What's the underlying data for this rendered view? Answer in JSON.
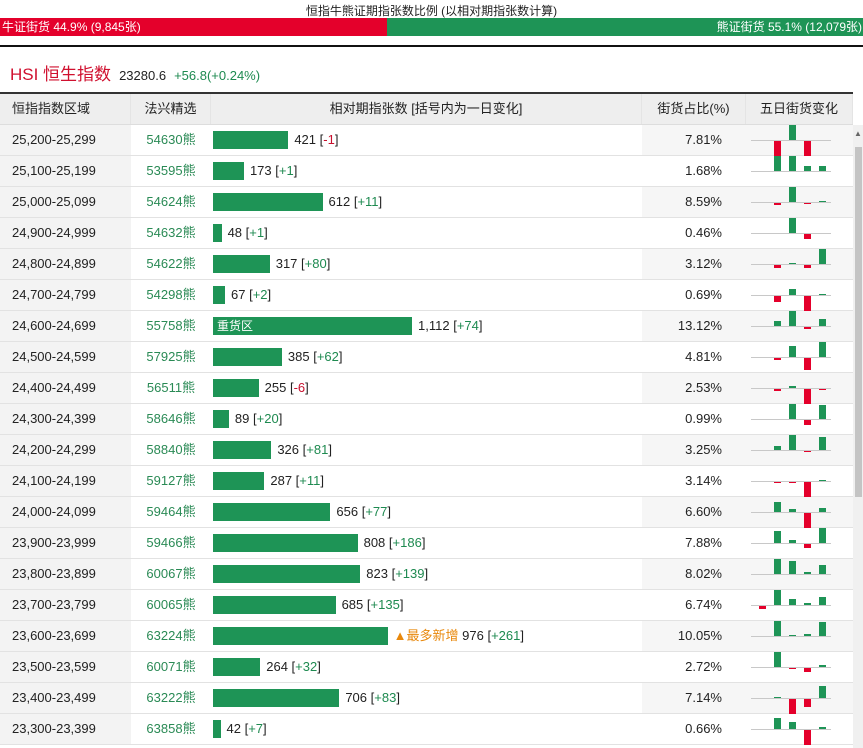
{
  "title": "恒指牛熊证期指张数比例 (以相对期指张数计算)",
  "ratio": {
    "bull_label": "牛证街货 44.9% (9,845张)",
    "bull_pct": 44.9,
    "bear_label": "熊证街货 55.1% (12,079张)",
    "bear_pct": 55.1
  },
  "index": {
    "name": "HSI 恒生指数",
    "value": "23280.6",
    "change": "+56.8(+0.24%)"
  },
  "headers": [
    "恒指指数区域",
    "法兴精选",
    "相对期指张数 [括号内为一日变化]",
    "街货占比(%)",
    "五日街货变化"
  ],
  "colors": {
    "green": "#1e9456",
    "red": "#e4002b",
    "note": "#e8880c"
  },
  "rows": [
    {
      "range": "25,200-25,299",
      "code": "54630熊",
      "count": 421,
      "count_label": "421",
      "delta": "-1",
      "pct": "7.81%",
      "five": [
        0,
        -15,
        15,
        -15,
        0
      ]
    },
    {
      "range": "25,100-25,199",
      "code": "53595熊",
      "count": 173,
      "count_label": "173",
      "delta": "+1",
      "pct": "1.68%",
      "five": [
        0,
        15,
        15,
        5,
        5
      ]
    },
    {
      "range": "25,000-25,099",
      "code": "54624熊",
      "count": 612,
      "count_label": "612",
      "delta": "+11",
      "pct": "8.59%",
      "five": [
        0,
        -2,
        15,
        -1,
        1
      ]
    },
    {
      "range": "24,900-24,999",
      "code": "54632熊",
      "count": 48,
      "count_label": "48",
      "delta": "+1",
      "pct": "0.46%",
      "five": [
        0,
        0,
        15,
        -5,
        0
      ]
    },
    {
      "range": "24,800-24,899",
      "code": "54622熊",
      "count": 317,
      "count_label": "317",
      "delta": "+80",
      "pct": "3.12%",
      "five": [
        0,
        -3,
        1,
        -3,
        15
      ]
    },
    {
      "range": "24,700-24,799",
      "code": "54298熊",
      "count": 67,
      "count_label": "67",
      "delta": "+2",
      "pct": "0.69%",
      "five": [
        0,
        -6,
        6,
        -15,
        1
      ]
    },
    {
      "range": "24,600-24,699",
      "code": "55758熊",
      "count": 1112,
      "count_label": "1,112",
      "delta": "+74",
      "pct": "13.12%",
      "bar_text": "重货区",
      "five": [
        0,
        5,
        15,
        -2,
        7
      ]
    },
    {
      "range": "24,500-24,599",
      "code": "57925熊",
      "count": 385,
      "count_label": "385",
      "delta": "+62",
      "pct": "4.81%",
      "five": [
        0,
        -2,
        11,
        -12,
        15
      ]
    },
    {
      "range": "24,400-24,499",
      "code": "56511熊",
      "count": 255,
      "count_label": "255",
      "delta": "-6",
      "pct": "2.53%",
      "five": [
        0,
        -2,
        2,
        -15,
        -1
      ]
    },
    {
      "range": "24,300-24,399",
      "code": "58646熊",
      "count": 89,
      "count_label": "89",
      "delta": "+20",
      "pct": "0.99%",
      "five": [
        0,
        0,
        15,
        -5,
        14
      ]
    },
    {
      "range": "24,200-24,299",
      "code": "58840熊",
      "count": 326,
      "count_label": "326",
      "delta": "+81",
      "pct": "3.25%",
      "five": [
        0,
        4,
        15,
        -1,
        13
      ]
    },
    {
      "range": "24,100-24,199",
      "code": "59127熊",
      "count": 287,
      "count_label": "287",
      "delta": "+11",
      "pct": "3.14%",
      "five": [
        0,
        -1,
        -1,
        -15,
        1
      ]
    },
    {
      "range": "24,000-24,099",
      "code": "59464熊",
      "count": 656,
      "count_label": "656",
      "delta": "+77",
      "pct": "6.60%",
      "five": [
        0,
        10,
        3,
        -15,
        4
      ]
    },
    {
      "range": "23,900-23,999",
      "code": "59466熊",
      "count": 808,
      "count_label": "808",
      "delta": "+186",
      "pct": "7.88%",
      "five": [
        0,
        12,
        3,
        -4,
        15
      ]
    },
    {
      "range": "23,800-23,899",
      "code": "60067熊",
      "count": 823,
      "count_label": "823",
      "delta": "+139",
      "pct": "8.02%",
      "five": [
        0,
        15,
        13,
        2,
        9
      ]
    },
    {
      "range": "23,700-23,799",
      "code": "60065熊",
      "count": 685,
      "count_label": "685",
      "delta": "+135",
      "pct": "6.74%",
      "five": [
        -3,
        15,
        6,
        2,
        8
      ]
    },
    {
      "range": "23,600-23,699",
      "code": "63224熊",
      "count": 976,
      "count_label": "976",
      "delta": "+261",
      "pct": "10.05%",
      "note": "▲最多新增",
      "five": [
        0,
        15,
        1,
        2,
        14
      ]
    },
    {
      "range": "23,500-23,599",
      "code": "60071熊",
      "count": 264,
      "count_label": "264",
      "delta": "+32",
      "pct": "2.72%",
      "five": [
        0,
        15,
        -1,
        -4,
        2
      ]
    },
    {
      "range": "23,400-23,499",
      "code": "63222熊",
      "count": 706,
      "count_label": "706",
      "delta": "+83",
      "pct": "7.14%",
      "five": [
        0,
        1,
        -15,
        -8,
        12
      ]
    },
    {
      "range": "23,300-23,399",
      "code": "63858熊",
      "count": 42,
      "count_label": "42",
      "delta": "+7",
      "pct": "0.66%",
      "five": [
        0,
        11,
        7,
        -15,
        2
      ]
    }
  ]
}
